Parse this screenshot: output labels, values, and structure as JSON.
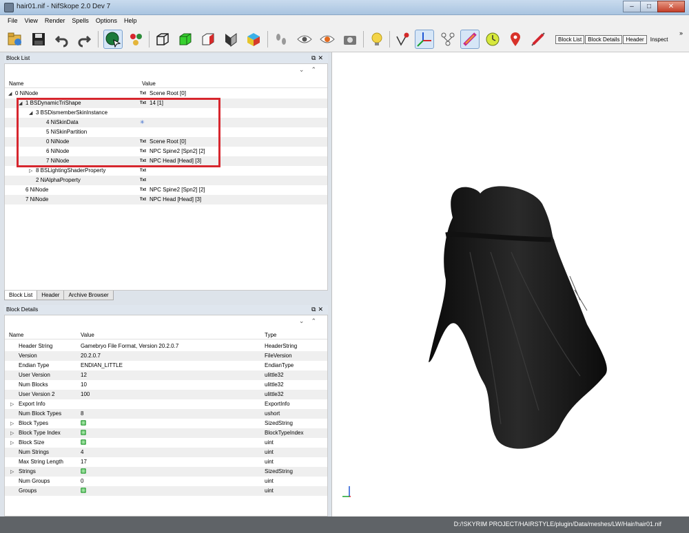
{
  "window": {
    "title": "hair01.nif - NifSkope 2.0 Dev 7",
    "minimize": "–",
    "maximize": "□",
    "close": "✕"
  },
  "menu": [
    {
      "label": "File"
    },
    {
      "label": "View"
    },
    {
      "label": "Render"
    },
    {
      "label": "Spells"
    },
    {
      "label": "Options"
    },
    {
      "label": "Help"
    }
  ],
  "toolbar": {
    "text_buttons": [
      "Block List",
      "Block Details",
      "Header"
    ],
    "inspect": "Inspect",
    "more": "»"
  },
  "block_list": {
    "title": "Block List",
    "columns": {
      "name": "Name",
      "value": "Value"
    },
    "rows": [
      {
        "name": "0 NiNode",
        "value": "Scene Root [0]",
        "txt": true,
        "indent": 0,
        "expanded": true
      },
      {
        "name": "1 BSDynamicTriShape",
        "value": "14 [1]",
        "txt": true,
        "indent": 1,
        "expanded": true
      },
      {
        "name": "3 BSDismemberSkinInstance",
        "value": "",
        "txt": false,
        "indent": 2,
        "expanded": true
      },
      {
        "name": "4 NiSkinData",
        "value": "",
        "txt": false,
        "indent": 3,
        "star": true
      },
      {
        "name": "5 NiSkinPartition",
        "value": "",
        "txt": false,
        "indent": 3
      },
      {
        "name": "0 NiNode",
        "value": "Scene Root [0]",
        "txt": true,
        "indent": 3
      },
      {
        "name": "6 NiNode",
        "value": "NPC Spine2 [Spn2] [2]",
        "txt": true,
        "indent": 3
      },
      {
        "name": "7 NiNode",
        "value": "NPC Head [Head] [3]",
        "txt": true,
        "indent": 3
      },
      {
        "name": "8 BSLightingShaderProperty",
        "value": "",
        "txt": true,
        "indent": 2,
        "collapsed": true
      },
      {
        "name": "2 NiAlphaProperty",
        "value": "",
        "txt": true,
        "indent": 2
      },
      {
        "name": "6 NiNode",
        "value": "NPC Spine2 [Spn2] [2]",
        "txt": true,
        "indent": 1
      },
      {
        "name": "7 NiNode",
        "value": "NPC Head [Head] [3]",
        "txt": true,
        "indent": 1
      }
    ],
    "txt_label": "Txt",
    "tabs": [
      "Block List",
      "Header",
      "Archive Browser"
    ]
  },
  "block_details": {
    "title": "Block Details",
    "columns": {
      "name": "Name",
      "value": "Value",
      "type": "Type"
    },
    "rows": [
      {
        "name": "Header String",
        "value": "Gamebryo File Format, Version 20.2.0.7",
        "type": "HeaderString"
      },
      {
        "name": "Version",
        "value": "20.2.0.7",
        "type": "FileVersion"
      },
      {
        "name": "Endian Type",
        "value": "ENDIAN_LITTLE",
        "type": "EndianType"
      },
      {
        "name": "User Version",
        "value": "12",
        "type": "ulittle32"
      },
      {
        "name": "Num Blocks",
        "value": "10",
        "type": "ulittle32"
      },
      {
        "name": "User Version 2",
        "value": "100",
        "type": "ulittle32"
      },
      {
        "name": "Export Info",
        "value": "",
        "type": "ExportInfo",
        "expandable": true
      },
      {
        "name": "Num Block Types",
        "value": "8",
        "type": "ushort"
      },
      {
        "name": "Block Types",
        "value": "",
        "type": "SizedString",
        "expandable": true,
        "gem": true
      },
      {
        "name": "Block Type Index",
        "value": "",
        "type": "BlockTypeIndex",
        "expandable": true,
        "gem": true
      },
      {
        "name": "Block Size",
        "value": "",
        "type": "uint",
        "expandable": true,
        "gem": true
      },
      {
        "name": "Num Strings",
        "value": "4",
        "type": "uint"
      },
      {
        "name": "Max String Length",
        "value": "17",
        "type": "uint"
      },
      {
        "name": "Strings",
        "value": "",
        "type": "SizedString",
        "expandable": true,
        "gem": true
      },
      {
        "name": "Num Groups",
        "value": "0",
        "type": "uint"
      },
      {
        "name": "Groups",
        "value": "",
        "type": "uint",
        "gem": true
      }
    ]
  },
  "status": {
    "path": "D:/!SKYRIM PROJECT/HAIRSTYLE/plugin/Data/meshes/LW/Hair/hair01.nif"
  }
}
